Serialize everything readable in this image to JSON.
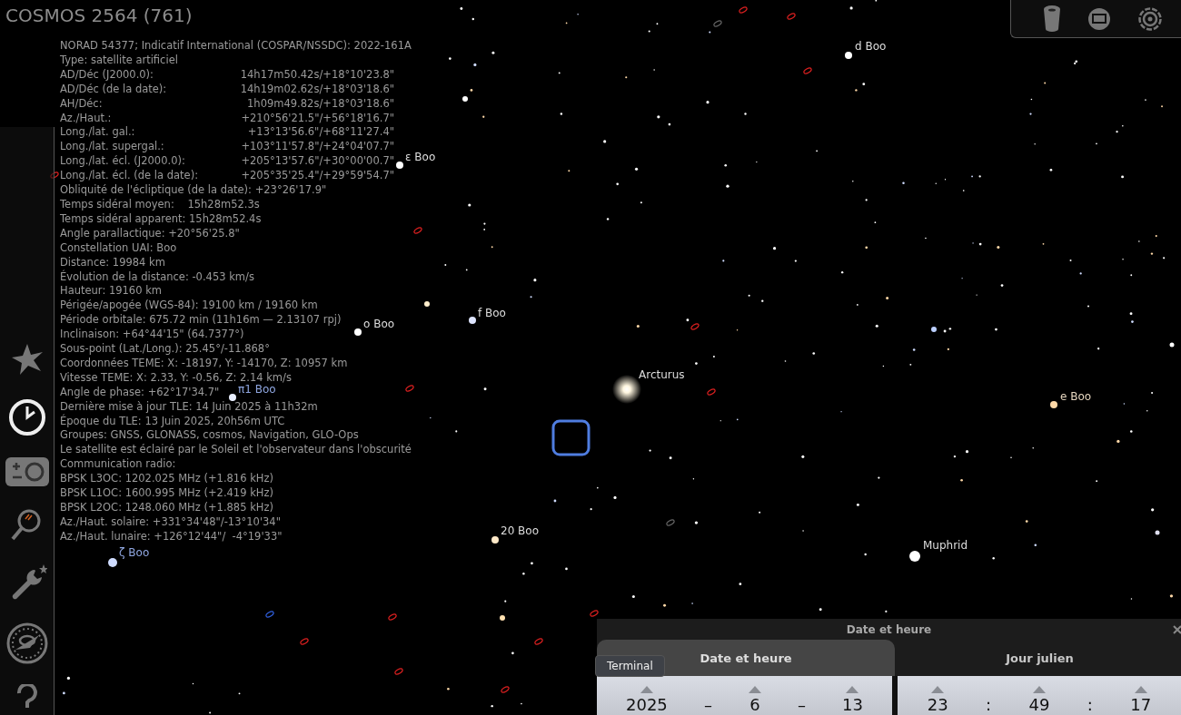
{
  "object": {
    "title": "COSMOS 2564 (761)"
  },
  "info": [
    {
      "kind": "text",
      "text": "NORAD 54377; Indicatif International (COSPAR/NSSDC): 2022-161A"
    },
    {
      "kind": "text",
      "text": "Type: satellite artificiel"
    },
    {
      "kind": "pair",
      "label": "AD/Déc (J2000.0):",
      "value": "14h17m50.42s/+18°10'23.8\""
    },
    {
      "kind": "pair",
      "label": "AD/Déc (de la date):",
      "value": "14h19m02.62s/+18°03'18.6\""
    },
    {
      "kind": "pair",
      "label": "AH/Déc:",
      "value": "1h09m49.82s/+18°03'18.6\""
    },
    {
      "kind": "pair",
      "label": "Az./Haut.:",
      "value": "+210°56'21.5\"/+56°18'16.7\""
    },
    {
      "kind": "pair",
      "label": "Long./lat. gal.:",
      "value": "+13°13'56.6\"/+68°11'27.4\""
    },
    {
      "kind": "pair",
      "label": "Long./lat. supergal.:",
      "value": "+103°11'57.8\"/+24°04'07.7\""
    },
    {
      "kind": "pair",
      "label": "Long./lat. écl. (J2000.0):",
      "value": "+205°13'57.6\"/+30°00'00.7\""
    },
    {
      "kind": "pair",
      "label": "Long./lat. écl. (de la date):",
      "value": "+205°35'25.4\"/+29°59'54.7\""
    },
    {
      "kind": "text",
      "text": "Obliquité de l'écliptique (de la date): +23°26'17.9\""
    },
    {
      "kind": "text",
      "text": "Temps sidéral moyen:    15h28m52.3s"
    },
    {
      "kind": "text",
      "text": "Temps sidéral apparent: 15h28m52.4s"
    },
    {
      "kind": "text",
      "text": "Angle parallactique: +20°56'25.8\""
    },
    {
      "kind": "text",
      "text": "Constellation UAI: Boo"
    },
    {
      "kind": "text",
      "text": "Distance: 19984 km"
    },
    {
      "kind": "text",
      "text": "Évolution de la distance: -0.453 km/s"
    },
    {
      "kind": "text",
      "text": "Hauteur: 19160 km"
    },
    {
      "kind": "text",
      "text": "Périgée/apogée (WGS-84): 19100 km / 19160 km"
    },
    {
      "kind": "text",
      "text": "Période orbitale: 675.72 min (11h16m — 2.13107 rpj)"
    },
    {
      "kind": "text",
      "text": "Inclinaison: +64°44'15\" (64.7377°)"
    },
    {
      "kind": "text",
      "text": "Sous-point (Lat./Long.): 25.45°/-11.868°"
    },
    {
      "kind": "text",
      "text": "Coordonnées TEME: X: -18197, Y: -14170, Z: 10957 km"
    },
    {
      "kind": "text",
      "text": "Vitesse TEME: X: 2.33, Y: -0.56, Z: 2.14 km/s"
    },
    {
      "kind": "text",
      "text": "Angle de phase: +62°17'34.7\""
    },
    {
      "kind": "text",
      "text": "Dernière mise à jour TLE: 14 Juin 2025 à 11h32m"
    },
    {
      "kind": "text",
      "text": "Époque du TLE: 13 Juin 2025, 20h56m UTC"
    },
    {
      "kind": "text",
      "text": "Groupes: GNSS, GLONASS, cosmos, Navigation, GLO-Ops"
    },
    {
      "kind": "text",
      "text": "Le satellite est éclairé par le Soleil et l'observateur dans l'obscurité"
    },
    {
      "kind": "text",
      "text": "Communication radio:"
    },
    {
      "kind": "text",
      "text": "BPSK L3OC: 1202.025 MHz (+1.816 kHz)"
    },
    {
      "kind": "text",
      "text": "BPSK L1OC: 1600.995 MHz (+2.419 kHz)"
    },
    {
      "kind": "text",
      "text": "BPSK L2OC: 1248.060 MHz (+1.885 kHz)"
    },
    {
      "kind": "text",
      "text": "Az./Haut. solaire: +331°34'48\"/-13°10'34\""
    },
    {
      "kind": "text",
      "text": "Az./Haut. lunaire: +126°12'44\"/  -4°19'33\""
    }
  ],
  "sky_labels": [
    {
      "name": "d Boo",
      "color": "#dddddd"
    },
    {
      "name": "ε Boo",
      "color": "#dddddd"
    },
    {
      "name": "f Boo",
      "color": "#dddddd"
    },
    {
      "name": "o Boo",
      "color": "#dddddd"
    },
    {
      "name": "π1 Boo",
      "color": "#8fa6e0"
    },
    {
      "name": "Arcturus",
      "color": "#dddddd"
    },
    {
      "name": "e Boo",
      "color": "#e6d6bf"
    },
    {
      "name": "20 Boo",
      "color": "#dddddd"
    },
    {
      "name": "Muphrid",
      "color": "#dddddd"
    },
    {
      "name": "ζ Boo",
      "color": "#8fa6e0"
    }
  ],
  "date_panel": {
    "title": "Date et heure",
    "tabs": [
      {
        "label": "Date et heure",
        "selected": true
      },
      {
        "label": "Jour julien",
        "selected": false
      }
    ],
    "date": [
      {
        "kind": "value",
        "text": "2025"
      },
      {
        "kind": "sep",
        "text": "–"
      },
      {
        "kind": "value",
        "text": "6"
      },
      {
        "kind": "sep",
        "text": "–"
      },
      {
        "kind": "value",
        "text": "13"
      }
    ],
    "time": [
      {
        "kind": "value",
        "text": "23"
      },
      {
        "kind": "sep",
        "text": ":"
      },
      {
        "kind": "value",
        "text": "49"
      },
      {
        "kind": "sep",
        "text": ":"
      },
      {
        "kind": "value",
        "text": "17"
      }
    ]
  },
  "tooltip": {
    "text": "Terminal"
  }
}
